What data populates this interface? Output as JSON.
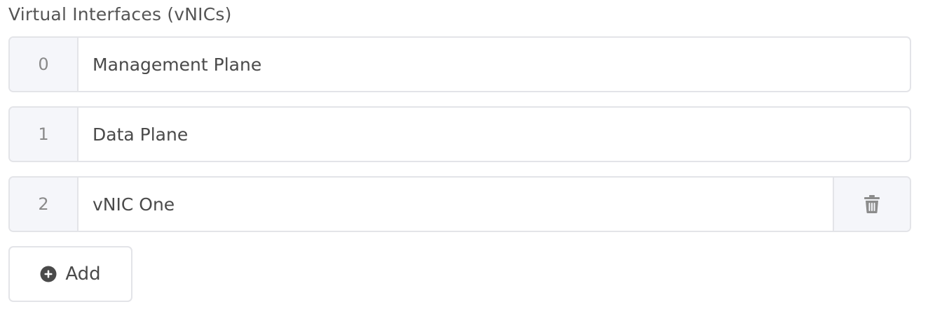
{
  "section": {
    "title": "Virtual Interfaces (vNICs)"
  },
  "vnics": [
    {
      "index": "0",
      "name": "Management Plane",
      "deletable": false
    },
    {
      "index": "1",
      "name": "Data Plane",
      "deletable": false
    },
    {
      "index": "2",
      "name": "vNIC One",
      "deletable": true
    }
  ],
  "icons": {
    "delete": "trash-icon",
    "add": "plus-circle-icon"
  },
  "actions": {
    "add_label": "Add"
  },
  "colors": {
    "border": "#e3e4e8",
    "addon_bg": "#f5f6fa",
    "text": "#4a4a4a",
    "muted_text": "#8a8a8a",
    "icon": "#8c8c8c",
    "add_icon": "#4a4a4a"
  }
}
